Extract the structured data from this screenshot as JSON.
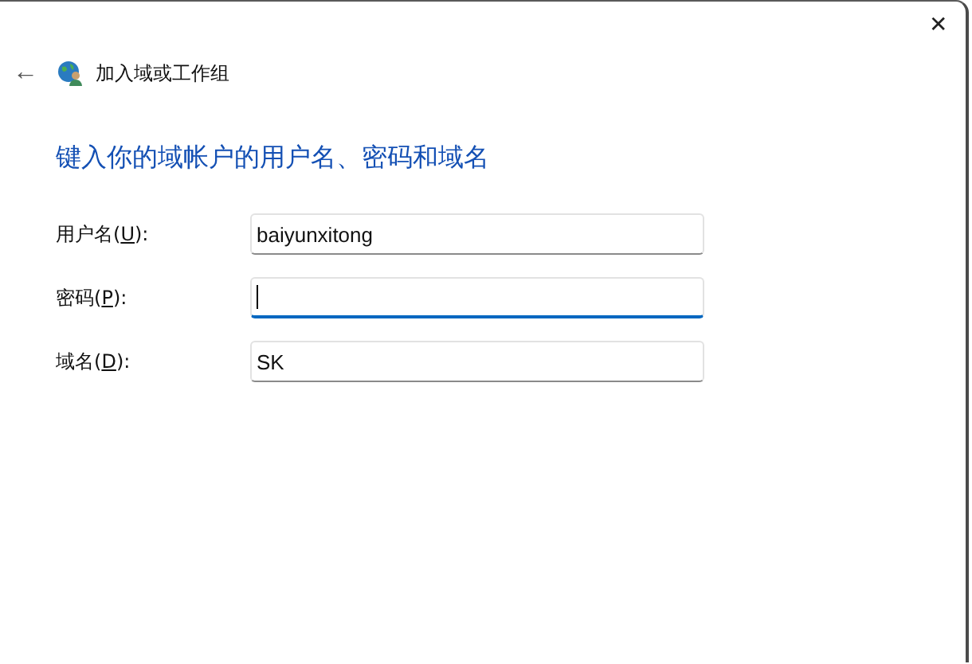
{
  "window": {
    "close_glyph": "✕"
  },
  "nav": {
    "back_glyph": "←",
    "title": "加入域或工作组"
  },
  "heading": "键入你的域帐户的用户名、密码和域名",
  "fields": [
    {
      "label_before": "用户名(",
      "access_key": "U",
      "label_after": "):",
      "value": "baiyunxitong",
      "focused": false
    },
    {
      "label_before": "密码(",
      "access_key": "P",
      "label_after": "):",
      "focused": true
    },
    {
      "label_before": "域名(",
      "access_key": "D",
      "label_after": "):",
      "value": "SK",
      "focused": false
    }
  ]
}
